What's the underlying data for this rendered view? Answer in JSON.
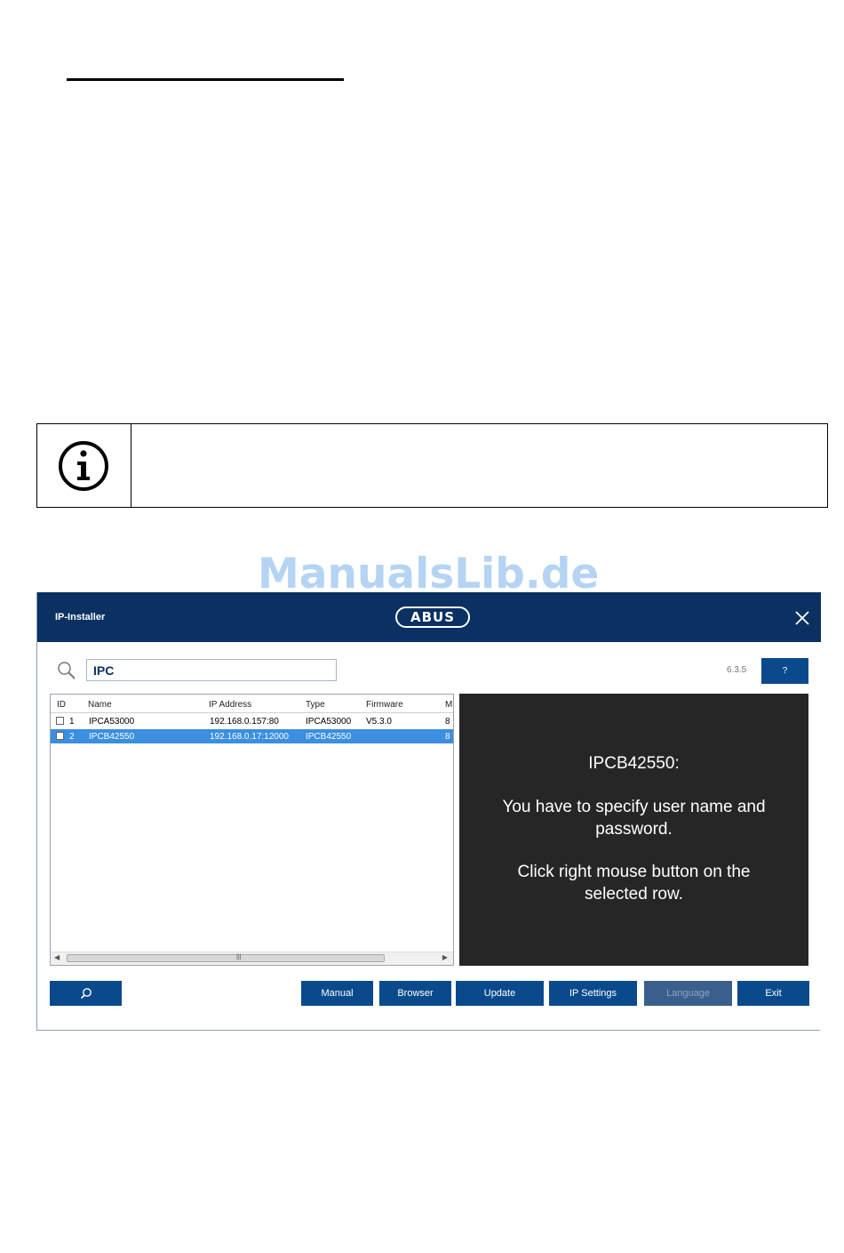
{
  "window": {
    "title": "IP-Installer",
    "logo_text": "ABUS",
    "close_icon": "close-icon"
  },
  "watermark": "ManualsLib.de",
  "info_icon": "info-icon",
  "search": {
    "icon": "search-icon",
    "value": "IPC",
    "placeholder": ""
  },
  "version": "6.3.5",
  "help_label": "?",
  "table": {
    "columns": [
      "ID",
      "Name",
      "IP Address",
      "Type",
      "Firmware",
      "M."
    ],
    "rows": [
      {
        "id": "1",
        "name": "IPCA53000",
        "ip": "192.168.0.157:80",
        "type": "IPCA53000",
        "firmware": "V5.3.0",
        "mac": "8",
        "selected": false,
        "checked": false
      },
      {
        "id": "2",
        "name": "IPCB42550",
        "ip": "192.168.0.17:12000",
        "type": "IPCB42550",
        "firmware": "",
        "mac": "8",
        "selected": true,
        "checked": false
      }
    ]
  },
  "message": {
    "line1": "IPCB42550:",
    "line2": "You have to specify user name and",
    "line3": "password.",
    "line4": "Click right mouse button on the",
    "line5": "selected row."
  },
  "buttons": {
    "scan_icon": "search-icon",
    "manual": "Manual",
    "browser": "Browser",
    "update": "Update",
    "ip_settings": "IP Settings",
    "language": "Language",
    "exit": "Exit"
  },
  "colors": {
    "titlebar": "#0a3162",
    "button": "#0a4a8c",
    "selected_row": "#3a8fe0",
    "message_bg": "#262626"
  }
}
